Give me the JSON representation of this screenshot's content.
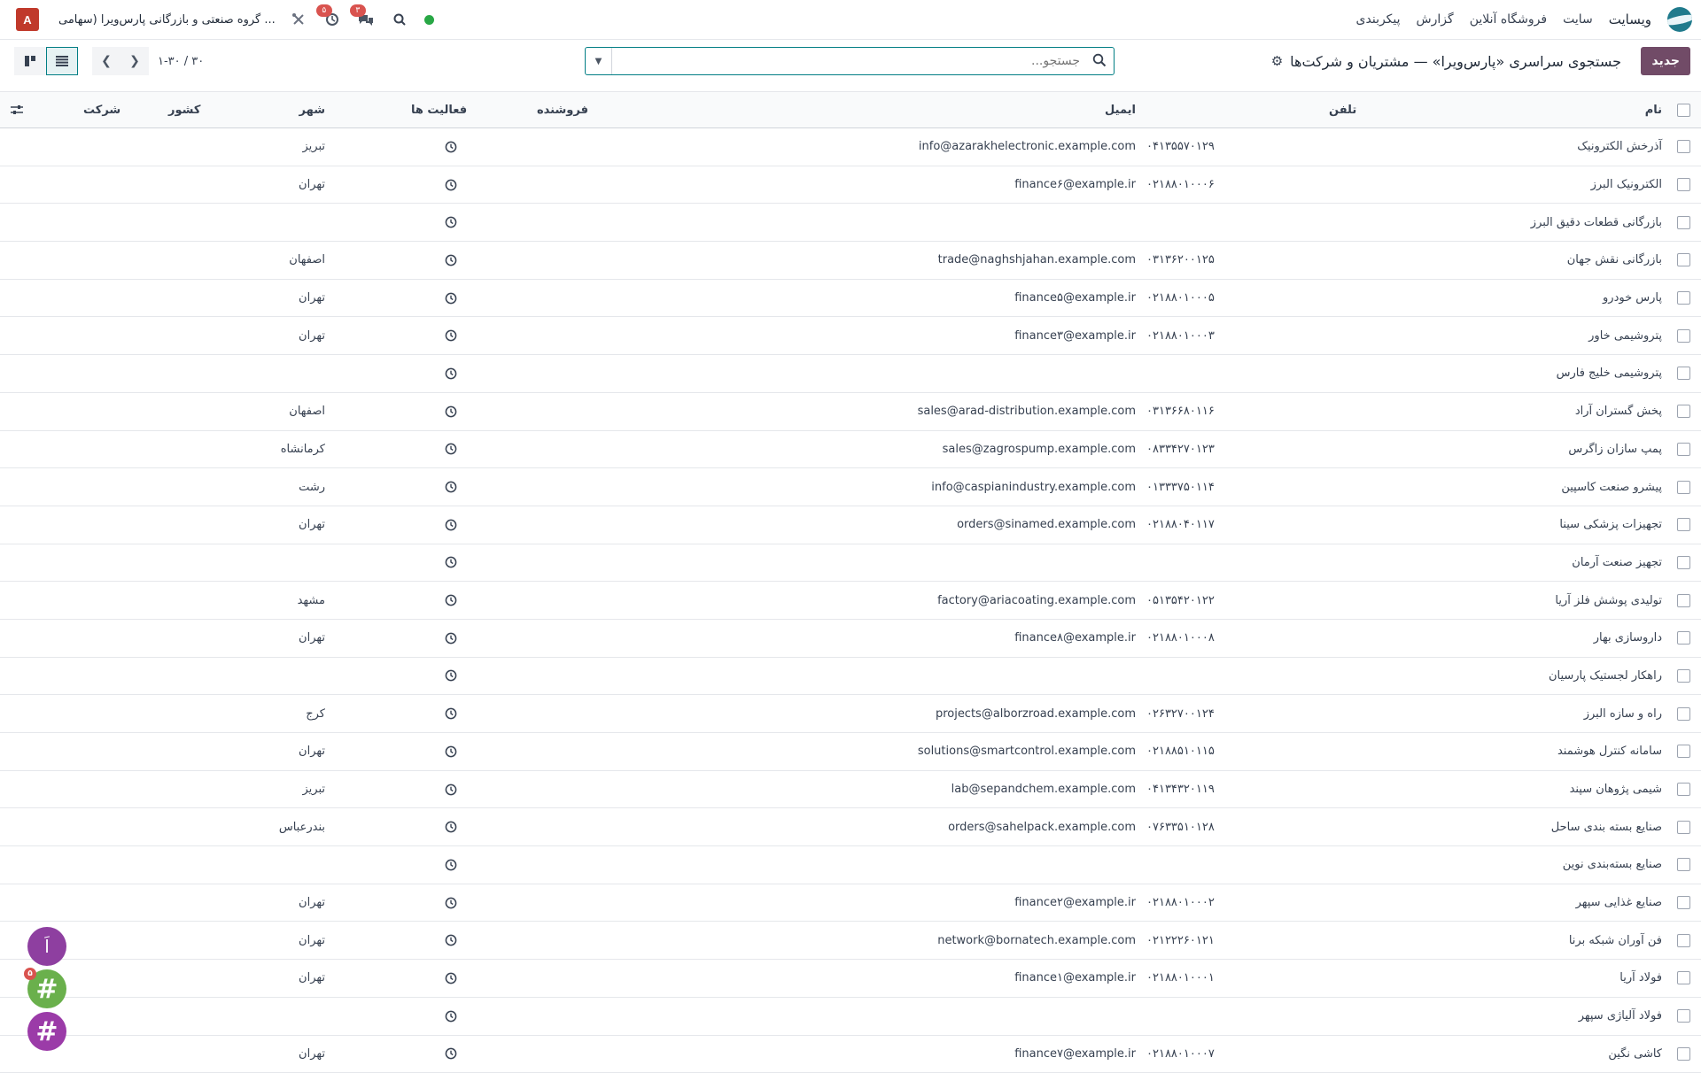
{
  "navbar": {
    "brand": "ویسایت",
    "menu": [
      "سایت",
      "فروشگاه آنلاین",
      "گزارش",
      "پیکربندی"
    ],
    "company": "گروه صنعتی و بازرگانی پارس‌ویرا (سهامی ...",
    "avatar_letter": "A",
    "activity_count": "۵",
    "messages_count": "۳"
  },
  "control_panel": {
    "new_button": "جدید",
    "breadcrumb": "جستجوی سراسری «پارس‌ویرا» — مشتریان و شرکت‌ها",
    "search_placeholder": "جستجو...",
    "pager_value": "۱-۳۰ / ۳۰"
  },
  "list": {
    "columns": {
      "name": "نام",
      "phone": "تلفن",
      "email": "ایمیل",
      "salesperson": "فروشنده",
      "activities": "فعالیت ها",
      "city": "شهر",
      "country": "کشور",
      "company": "شرکت"
    },
    "rows": [
      {
        "name": "آذرخش الکترونیک",
        "phone": "۰۴۱۳۵۵۷۰۱۲۹",
        "email": "info@azarakhelectronic.example.com",
        "city": "تبریز"
      },
      {
        "name": "الکترونیک البرز",
        "phone": "۰۲۱۸۸۰۱۰۰۰۶",
        "email": "finance۶@example.ir",
        "city": "تهران"
      },
      {
        "name": "بازرگانی قطعات دقیق البرز",
        "phone": "",
        "email": "",
        "city": ""
      },
      {
        "name": "بازرگانی نقش جهان",
        "phone": "۰۳۱۳۶۲۰۰۱۲۵",
        "email": "trade@naghshjahan.example.com",
        "city": "اصفهان"
      },
      {
        "name": "پارس خودرو",
        "phone": "۰۲۱۸۸۰۱۰۰۰۵",
        "email": "finance۵@example.ir",
        "city": "تهران"
      },
      {
        "name": "پتروشیمی خاور",
        "phone": "۰۲۱۸۸۰۱۰۰۰۳",
        "email": "finance۳@example.ir",
        "city": "تهران"
      },
      {
        "name": "پتروشیمی خلیج فارس",
        "phone": "",
        "email": "",
        "city": ""
      },
      {
        "name": "پخش گستران آراد",
        "phone": "۰۳۱۳۶۶۸۰۱۱۶",
        "email": "sales@arad-distribution.example.com",
        "city": "اصفهان"
      },
      {
        "name": "پمپ سازان زاگرس",
        "phone": "۰۸۳۳۴۲۷۰۱۲۳",
        "email": "sales@zagrospump.example.com",
        "city": "کرمانشاه"
      },
      {
        "name": "پیشرو صنعت کاسپین",
        "phone": "۰۱۳۳۳۷۵۰۱۱۴",
        "email": "info@caspianindustry.example.com",
        "city": "رشت"
      },
      {
        "name": "تجهیزات پزشکی سینا",
        "phone": "۰۲۱۸۸۰۴۰۱۱۷",
        "email": "orders@sinamed.example.com",
        "city": "تهران"
      },
      {
        "name": "تجهیز صنعت آرمان",
        "phone": "",
        "email": "",
        "city": ""
      },
      {
        "name": "تولیدی پوشش فلز آریا",
        "phone": "۰۵۱۳۵۴۲۰۱۲۲",
        "email": "factory@ariacoating.example.com",
        "city": "مشهد"
      },
      {
        "name": "داروسازی بهار",
        "phone": "۰۲۱۸۸۰۱۰۰۰۸",
        "email": "finance۸@example.ir",
        "city": "تهران"
      },
      {
        "name": "راهکار لجستیک پارسیان",
        "phone": "",
        "email": "",
        "city": ""
      },
      {
        "name": "راه و سازه البرز",
        "phone": "۰۲۶۳۲۷۰۰۱۲۴",
        "email": "projects@alborzroad.example.com",
        "city": "کرج"
      },
      {
        "name": "سامانه کنترل هوشمند",
        "phone": "۰۲۱۸۸۵۱۰۱۱۵",
        "email": "solutions@smartcontrol.example.com",
        "city": "تهران"
      },
      {
        "name": "شیمی پژوهان سپند",
        "phone": "۰۴۱۳۴۳۲۰۱۱۹",
        "email": "lab@sepandchem.example.com",
        "city": "تبریز"
      },
      {
        "name": "صنایع بسته بندی ساحل",
        "phone": "۰۷۶۳۳۵۱۰۱۲۸",
        "email": "orders@sahelpack.example.com",
        "city": "بندرعباس"
      },
      {
        "name": "صنایع بسته‌بندی نوین",
        "phone": "",
        "email": "",
        "city": ""
      },
      {
        "name": "صنایع غذایی سپهر",
        "phone": "۰۲۱۸۸۰۱۰۰۰۲",
        "email": "finance۲@example.ir",
        "city": "تهران"
      },
      {
        "name": "فن آوران شبکه برنا",
        "phone": "۰۲۱۲۲۲۶۰۱۲۱",
        "email": "network@bornatech.example.com",
        "city": "تهران"
      },
      {
        "name": "فولاد آریا",
        "phone": "۰۲۱۸۸۰۱۰۰۰۱",
        "email": "finance۱@example.ir",
        "city": "تهران"
      },
      {
        "name": "فولاد آلیاژی سپهر",
        "phone": "",
        "email": "",
        "city": ""
      },
      {
        "name": "کاشی نگین",
        "phone": "۰۲۱۸۸۰۱۰۰۰۷",
        "email": "finance۷@example.ir",
        "city": "تهران"
      }
    ]
  },
  "bubbles": {
    "first_letter": "اَ",
    "hash_symbol": "#",
    "badge_count": "۵"
  }
}
